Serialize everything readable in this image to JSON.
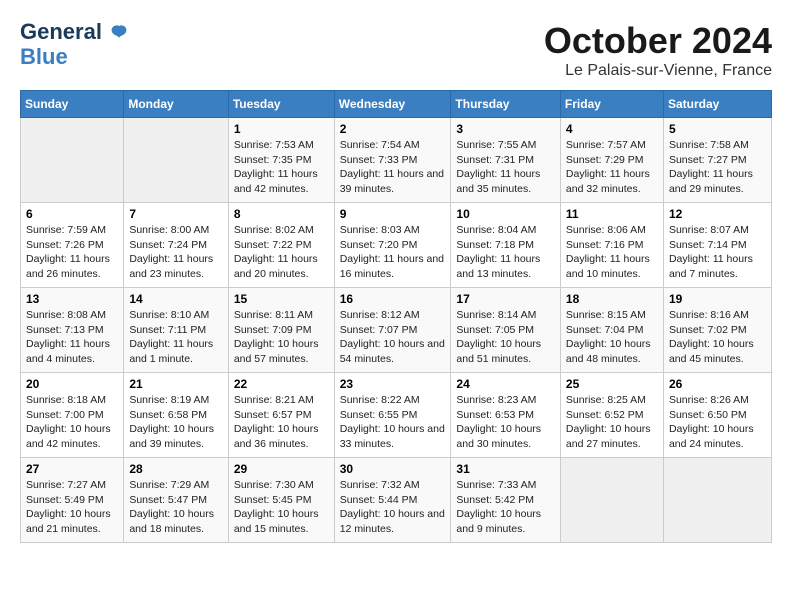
{
  "logo": {
    "line1": "General",
    "line2": "Blue"
  },
  "title": "October 2024",
  "location": "Le Palais-sur-Vienne, France",
  "headers": [
    "Sunday",
    "Monday",
    "Tuesday",
    "Wednesday",
    "Thursday",
    "Friday",
    "Saturday"
  ],
  "weeks": [
    [
      {
        "day": "",
        "info": ""
      },
      {
        "day": "",
        "info": ""
      },
      {
        "day": "1",
        "info": "Sunrise: 7:53 AM\nSunset: 7:35 PM\nDaylight: 11 hours and 42 minutes."
      },
      {
        "day": "2",
        "info": "Sunrise: 7:54 AM\nSunset: 7:33 PM\nDaylight: 11 hours and 39 minutes."
      },
      {
        "day": "3",
        "info": "Sunrise: 7:55 AM\nSunset: 7:31 PM\nDaylight: 11 hours and 35 minutes."
      },
      {
        "day": "4",
        "info": "Sunrise: 7:57 AM\nSunset: 7:29 PM\nDaylight: 11 hours and 32 minutes."
      },
      {
        "day": "5",
        "info": "Sunrise: 7:58 AM\nSunset: 7:27 PM\nDaylight: 11 hours and 29 minutes."
      }
    ],
    [
      {
        "day": "6",
        "info": "Sunrise: 7:59 AM\nSunset: 7:26 PM\nDaylight: 11 hours and 26 minutes."
      },
      {
        "day": "7",
        "info": "Sunrise: 8:00 AM\nSunset: 7:24 PM\nDaylight: 11 hours and 23 minutes."
      },
      {
        "day": "8",
        "info": "Sunrise: 8:02 AM\nSunset: 7:22 PM\nDaylight: 11 hours and 20 minutes."
      },
      {
        "day": "9",
        "info": "Sunrise: 8:03 AM\nSunset: 7:20 PM\nDaylight: 11 hours and 16 minutes."
      },
      {
        "day": "10",
        "info": "Sunrise: 8:04 AM\nSunset: 7:18 PM\nDaylight: 11 hours and 13 minutes."
      },
      {
        "day": "11",
        "info": "Sunrise: 8:06 AM\nSunset: 7:16 PM\nDaylight: 11 hours and 10 minutes."
      },
      {
        "day": "12",
        "info": "Sunrise: 8:07 AM\nSunset: 7:14 PM\nDaylight: 11 hours and 7 minutes."
      }
    ],
    [
      {
        "day": "13",
        "info": "Sunrise: 8:08 AM\nSunset: 7:13 PM\nDaylight: 11 hours and 4 minutes."
      },
      {
        "day": "14",
        "info": "Sunrise: 8:10 AM\nSunset: 7:11 PM\nDaylight: 11 hours and 1 minute."
      },
      {
        "day": "15",
        "info": "Sunrise: 8:11 AM\nSunset: 7:09 PM\nDaylight: 10 hours and 57 minutes."
      },
      {
        "day": "16",
        "info": "Sunrise: 8:12 AM\nSunset: 7:07 PM\nDaylight: 10 hours and 54 minutes."
      },
      {
        "day": "17",
        "info": "Sunrise: 8:14 AM\nSunset: 7:05 PM\nDaylight: 10 hours and 51 minutes."
      },
      {
        "day": "18",
        "info": "Sunrise: 8:15 AM\nSunset: 7:04 PM\nDaylight: 10 hours and 48 minutes."
      },
      {
        "day": "19",
        "info": "Sunrise: 8:16 AM\nSunset: 7:02 PM\nDaylight: 10 hours and 45 minutes."
      }
    ],
    [
      {
        "day": "20",
        "info": "Sunrise: 8:18 AM\nSunset: 7:00 PM\nDaylight: 10 hours and 42 minutes."
      },
      {
        "day": "21",
        "info": "Sunrise: 8:19 AM\nSunset: 6:58 PM\nDaylight: 10 hours and 39 minutes."
      },
      {
        "day": "22",
        "info": "Sunrise: 8:21 AM\nSunset: 6:57 PM\nDaylight: 10 hours and 36 minutes."
      },
      {
        "day": "23",
        "info": "Sunrise: 8:22 AM\nSunset: 6:55 PM\nDaylight: 10 hours and 33 minutes."
      },
      {
        "day": "24",
        "info": "Sunrise: 8:23 AM\nSunset: 6:53 PM\nDaylight: 10 hours and 30 minutes."
      },
      {
        "day": "25",
        "info": "Sunrise: 8:25 AM\nSunset: 6:52 PM\nDaylight: 10 hours and 27 minutes."
      },
      {
        "day": "26",
        "info": "Sunrise: 8:26 AM\nSunset: 6:50 PM\nDaylight: 10 hours and 24 minutes."
      }
    ],
    [
      {
        "day": "27",
        "info": "Sunrise: 7:27 AM\nSunset: 5:49 PM\nDaylight: 10 hours and 21 minutes."
      },
      {
        "day": "28",
        "info": "Sunrise: 7:29 AM\nSunset: 5:47 PM\nDaylight: 10 hours and 18 minutes."
      },
      {
        "day": "29",
        "info": "Sunrise: 7:30 AM\nSunset: 5:45 PM\nDaylight: 10 hours and 15 minutes."
      },
      {
        "day": "30",
        "info": "Sunrise: 7:32 AM\nSunset: 5:44 PM\nDaylight: 10 hours and 12 minutes."
      },
      {
        "day": "31",
        "info": "Sunrise: 7:33 AM\nSunset: 5:42 PM\nDaylight: 10 hours and 9 minutes."
      },
      {
        "day": "",
        "info": ""
      },
      {
        "day": "",
        "info": ""
      }
    ]
  ]
}
